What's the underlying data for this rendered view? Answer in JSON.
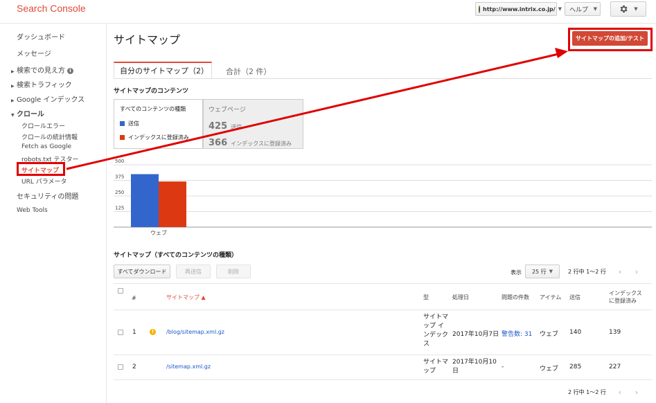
{
  "header": {
    "logo": "Search Console",
    "site": "http://www.intrix.co.jp/",
    "help": "ヘルプ"
  },
  "sidebar": {
    "items": [
      {
        "label": "ダッシュボード"
      },
      {
        "label": "メッセージ"
      },
      {
        "label": "検索での見え方"
      },
      {
        "label": "検索トラフィック"
      },
      {
        "label": "Google インデックス"
      },
      {
        "label": "クロール"
      }
    ],
    "crawl_sub": [
      {
        "label": "クロールエラー"
      },
      {
        "label": "クロールの統計情報"
      },
      {
        "label": "Fetch as Google"
      },
      {
        "label": "robots.txt テスター"
      },
      {
        "label": "サイトマップ"
      },
      {
        "label": "URL パラメータ"
      }
    ],
    "security": "セキュリティの問題",
    "web_tools": "Web Tools"
  },
  "main": {
    "title": "サイトマップ",
    "add_test_button": "サイトマップの追加/テスト",
    "tab_mine": "自分のサイトマップ（2）",
    "tab_all": "合計（2 件）",
    "contents_heading": "サイトマップのコンテンツ",
    "legend": {
      "title": "すべてのコンテンツの種類",
      "submitted": "送信",
      "indexed": "インデックスに登録済み"
    },
    "web": {
      "title": "ウェブページ",
      "submitted_count": "425",
      "submitted_label": "送信",
      "indexed_count": "366",
      "indexed_label": "インデックスに登録済み"
    },
    "table_heading": "サイトマップ（すべてのコンテンツの種類）",
    "toolbar": {
      "download_all": "すべてダウンロード",
      "resubmit": "再送信",
      "delete": "削除",
      "show": "表示",
      "rows": "25 行",
      "range_top": "2 行中 1～2 行",
      "range_bottom": "2 行中 1～2 行"
    },
    "columns": {
      "num": "#",
      "sitemap": "サイトマップ ▲",
      "type": "型",
      "processed": "処理日",
      "issues": "問題の件数",
      "items": "アイテム",
      "submitted": "送信",
      "indexed_1": "インデックス",
      "indexed_2": "に登録済み"
    },
    "rows": [
      {
        "num": "1",
        "path": "/blog/sitemap.xml.gz",
        "type": [
          "サイトマ",
          "ップ イ",
          "ンデック",
          "ス"
        ],
        "date": [
          "2017年10月7日"
        ],
        "issues": "警告数: 31",
        "item": "ウェブ",
        "submitted": "140",
        "indexed": "139"
      },
      {
        "num": "2",
        "path": "/sitemap.xml.gz",
        "type": [
          "サイトマ",
          "ップ"
        ],
        "date": [
          "2017年10月10",
          "日"
        ],
        "issues": "-",
        "item": "ウェブ",
        "submitted": "285",
        "indexed": "227"
      }
    ]
  },
  "chart_data": {
    "type": "bar",
    "categories": [
      "ウェブ"
    ],
    "series": [
      {
        "name": "送信",
        "values": [
          425
        ],
        "color": "#3366cc"
      },
      {
        "name": "インデックスに登録済み",
        "values": [
          366
        ],
        "color": "#dc3912"
      }
    ],
    "yticks": [
      "500",
      "375",
      "250",
      "125"
    ],
    "ylim": [
      0,
      500
    ],
    "grid": true
  },
  "colors": {
    "accent": "#dd4b39",
    "button_red": "#d14836",
    "annotation_red": "#e00000",
    "link": "#1a55c8"
  }
}
